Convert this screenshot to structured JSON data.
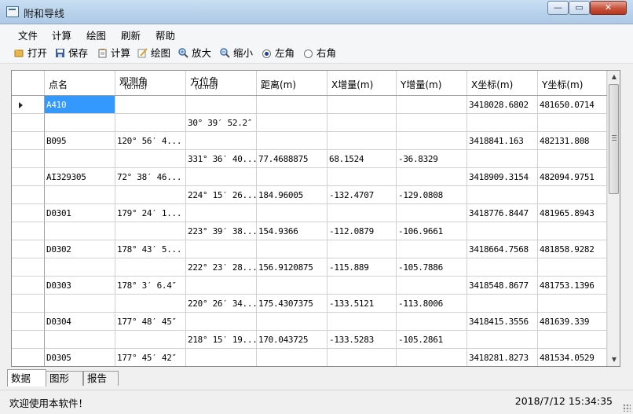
{
  "window": {
    "title": "附和导线",
    "min_symbol": "—",
    "max_symbol": "▭",
    "close_symbol": "✕"
  },
  "menu": [
    "文件",
    "计算",
    "绘图",
    "刷新",
    "帮助"
  ],
  "toolbar": {
    "open": "打开",
    "save": "保存",
    "calc": "计算",
    "draw": "绘图",
    "zoom_in": "放大",
    "zoom_out": "缩小",
    "left_angle": "左角",
    "right_angle": "右角",
    "selected_angle": "left"
  },
  "columns": [
    {
      "line1": "点名",
      "line2": ""
    },
    {
      "line1": "观测角",
      "line2": "(d.ms)"
    },
    {
      "line1": "方位角",
      "line2": "(d.ms)"
    },
    {
      "line1": "距离(m)",
      "line2": ""
    },
    {
      "line1": "X增量(m)",
      "line2": ""
    },
    {
      "line1": "Y增量(m)",
      "line2": ""
    },
    {
      "line1": "X坐标(m)",
      "line2": ""
    },
    {
      "line1": "Y坐标(m)",
      "line2": ""
    }
  ],
  "rows": [
    [
      "A410",
      "",
      "",
      "",
      "",
      "",
      "3418028.6802",
      "481650.0714"
    ],
    [
      "",
      "",
      "30° 39′ 52.2″",
      "",
      "",
      "",
      "",
      ""
    ],
    [
      "B095",
      "120° 56′ 4...",
      "",
      "",
      "",
      "",
      "3418841.163",
      "482131.808"
    ],
    [
      "",
      "",
      "331° 36′ 40...",
      "77.4688875",
      "68.1524",
      "-36.8329",
      "",
      ""
    ],
    [
      "AI329305",
      "72° 38′ 46...",
      "",
      "",
      "",
      "",
      "3418909.3154",
      "482094.9751"
    ],
    [
      "",
      "",
      "224° 15′ 26...",
      "184.96005",
      "-132.4707",
      "-129.0808",
      "",
      ""
    ],
    [
      "D0301",
      "179° 24′ 1...",
      "",
      "",
      "",
      "",
      "3418776.8447",
      "481965.8943"
    ],
    [
      "",
      "",
      "223° 39′ 38...",
      "154.9366",
      "-112.0879",
      "-106.9661",
      "",
      ""
    ],
    [
      "D0302",
      "178° 43′ 5...",
      "",
      "",
      "",
      "",
      "3418664.7568",
      "481858.9282"
    ],
    [
      "",
      "",
      "222° 23′ 28...",
      "156.9120875",
      "-115.889",
      "-105.7886",
      "",
      ""
    ],
    [
      "D0303",
      "178° 3′ 6.4″",
      "",
      "",
      "",
      "",
      "3418548.8677",
      "481753.1396"
    ],
    [
      "",
      "",
      "220° 26′ 34...",
      "175.4307375",
      "-133.5121",
      "-113.8006",
      "",
      ""
    ],
    [
      "D0304",
      "177° 48′ 45″",
      "",
      "",
      "",
      "",
      "3418415.3556",
      "481639.339"
    ],
    [
      "",
      "",
      "218° 15′ 19...",
      "170.043725",
      "-133.5283",
      "-105.2861",
      "",
      ""
    ],
    [
      "D0305",
      "177° 45′ 42″",
      "",
      "",
      "",
      "",
      "3418281.8273",
      "481534.0529"
    ]
  ],
  "selected_cell": {
    "row": 0,
    "col": 0
  },
  "tabs": [
    "数据",
    "图形",
    "报告"
  ],
  "active_tab": 0,
  "status": {
    "message": "欢迎使用本软件！",
    "datetime": "2018/7/12 15:34:35"
  },
  "colors": {
    "selection": "#3399ff",
    "title_gradient": "#b7d1ea",
    "close_button": "#c7523a"
  }
}
